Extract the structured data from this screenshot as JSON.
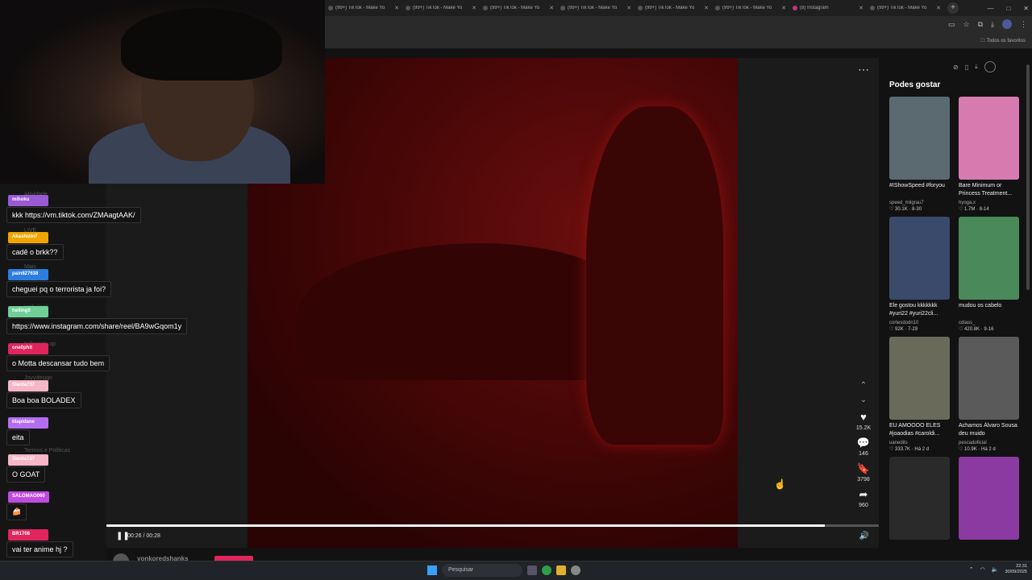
{
  "browser": {
    "tabs": [
      {
        "title": "(99+) TikTok - Make Yo",
        "icon": "tiktok-icon"
      },
      {
        "title": "(99+) TikTok - Make Yo",
        "icon": "tiktok-icon"
      },
      {
        "title": "(99+) TikTok - Make Yo",
        "icon": "tiktok-icon"
      },
      {
        "title": "(99+) TikTok - Make Yo",
        "icon": "tiktok-icon"
      },
      {
        "title": "(99+) TikTok - Make Yo",
        "icon": "tiktok-icon"
      },
      {
        "title": "(99+) TikTok - Make Yo",
        "icon": "tiktok-icon"
      },
      {
        "title": "(8) Instagram",
        "icon": "instagram-icon"
      },
      {
        "title": "(99+) TikTok - Make Yo",
        "icon": "tiktok-icon"
      }
    ],
    "all_bookmarks": "Todos os favoritos"
  },
  "chat": [
    {
      "user": "mihoku",
      "color": "#9b59d6",
      "text": "kkk https://vm.tiktok.com/ZMAagtAAK/"
    },
    {
      "user": "Akashizin7",
      "color": "#f0a500",
      "text": "cadê o brkk??"
    },
    {
      "user": "pain827638",
      "color": "#2d7de0",
      "text": "cheguei pq o terrorista ja foi?"
    },
    {
      "user": "heiling0",
      "color": "#6fcf97",
      "text": "https://www.instagram.com/share/reel/BA9wGqom1y"
    },
    {
      "user": "one0phit",
      "color": "#e0245e",
      "text": "o Motta descansar tudo bem"
    },
    {
      "user": "Slenta737",
      "color": "#f7b6c8",
      "text": "Boa boa BOLADEX"
    },
    {
      "user": "tilapidane",
      "color": "#b36ef0",
      "text": "eita"
    },
    {
      "user": "Slenta737",
      "color": "#f7b6c8",
      "text": "O GOAT"
    },
    {
      "user": "SALOMAO060",
      "color": "#c04be0",
      "text": "🍰"
    },
    {
      "user": "BR1708",
      "color": "#e0245e",
      "text": "vai ter anime hj ?"
    }
  ],
  "sidenav_faint": [
    "Atividade",
    "LIVE",
    "Mais",
    "jaobulanii",
    "ackcortes",
    "todocorte.op",
    "Joyydesign",
    "Termos e Políticas"
  ],
  "video": {
    "time": "00:26 / 00:28",
    "progress_fraction": 0.93,
    "author": "yonkoredshanks",
    "likes": "15.2K",
    "comments": "146",
    "saves": "3798",
    "shares": "960"
  },
  "suggestions": {
    "title": "Podes gostar",
    "items": [
      {
        "title": "#IShowSpeed #foryou",
        "author": "speed_milgrau7",
        "stats": "♡ 30.1K · 8-30",
        "thumb_color": "#5a6a70"
      },
      {
        "title": "Bare Minimum or Princess Treatment...",
        "author": "hyoga.x",
        "stats": "♡ 1.7M · 8-14",
        "thumb_color": "#d77ab0"
      },
      {
        "title": "Ele gostou kkkkkkk #yuri22 #yuri22cli...",
        "author": "cortesdodn10",
        "stats": "♡ 92K · 7-29",
        "thumb_color": "#3a4a6a"
      },
      {
        "title": "mudou os cabelo",
        "author": "cdiass_",
        "stats": "♡ 420.8K · 9-16",
        "thumb_color": "#4a8a5a"
      },
      {
        "title": "EU AMOOOO ELES #joaodias #caroldi...",
        "author": "uanedits",
        "stats": "♡ 333.7K · Há 2 d",
        "thumb_color": "#6a6a5a"
      },
      {
        "title": "Achamos Álvaro Sousa deu muido",
        "author": "pescadoficial",
        "stats": "♡ 10.9K · Há 2 d",
        "thumb_color": "#5a5a5a"
      },
      {
        "title": "",
        "author": "",
        "stats": "",
        "thumb_color": "#2a2a2a"
      },
      {
        "title": "",
        "author": "",
        "stats": "",
        "thumb_color": "#8a3aa0"
      }
    ]
  },
  "taskbar": {
    "search_placeholder": "Pesquisar",
    "time": "22:31",
    "date": "30/09/2025"
  }
}
